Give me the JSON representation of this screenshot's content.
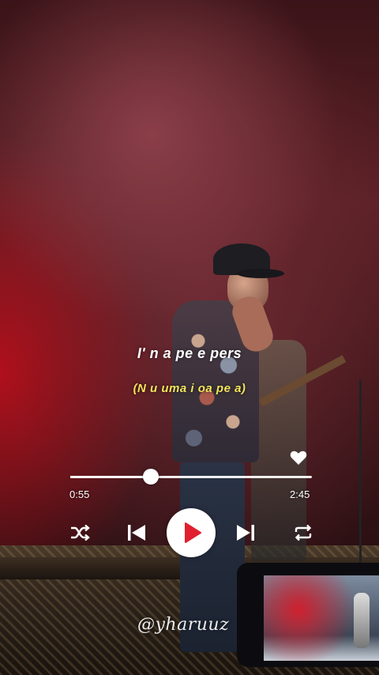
{
  "lyrics": {
    "line": "I'   n    a pe    e   pers",
    "translation": "(N        u uma   i   oa pe    a)"
  },
  "player": {
    "elapsed": "0:55",
    "total": "2:45",
    "progress": 0.333,
    "liked": true
  },
  "controls": {
    "shuffle_icon": "shuffle-icon",
    "previous_icon": "skip-previous-icon",
    "play_icon": "play-icon",
    "next_icon": "skip-next-icon",
    "repeat_icon": "repeat-icon",
    "heart_icon": "heart-icon"
  },
  "watermark": "@yharuuz",
  "colors": {
    "lyric": "#ffffff",
    "translation": "#f2e35a",
    "play_triangle": "#e0202e"
  }
}
